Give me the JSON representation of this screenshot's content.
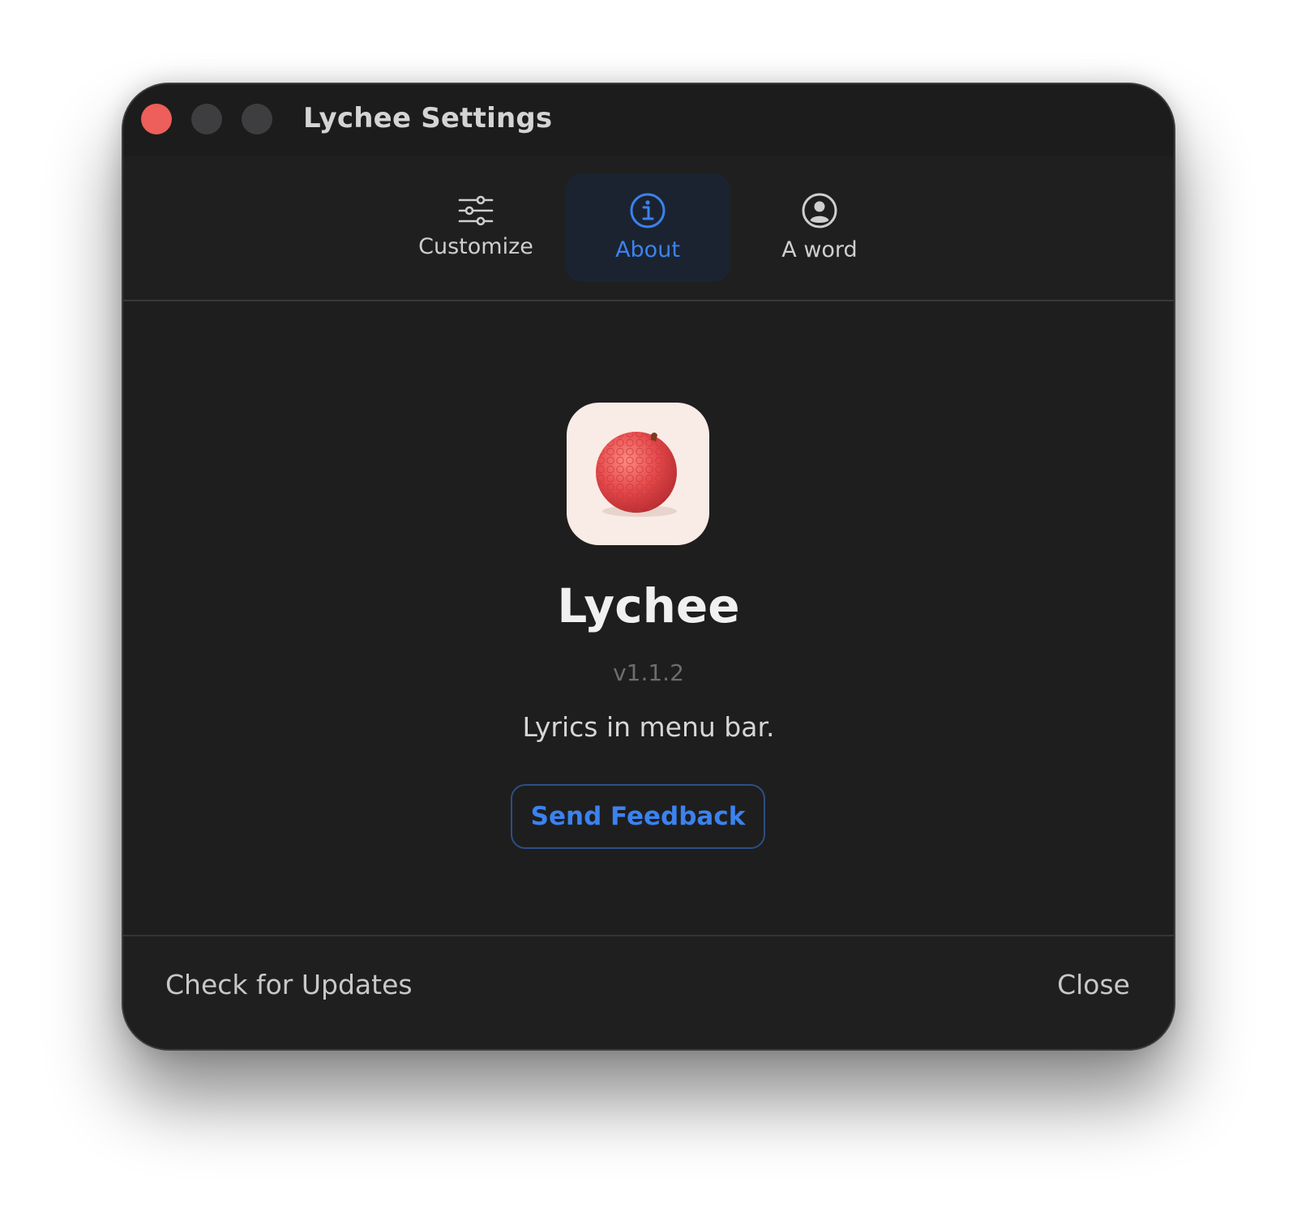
{
  "window": {
    "title": "Lychee Settings"
  },
  "toolbar": {
    "tabs": [
      {
        "label": "Customize",
        "icon": "sliders-icon",
        "selected": false
      },
      {
        "label": "About",
        "icon": "info-circle-icon",
        "selected": true
      },
      {
        "label": "A word",
        "icon": "person-circle-icon",
        "selected": false
      }
    ]
  },
  "about": {
    "app_icon": "lychee-fruit-icon",
    "app_name": "Lychee",
    "version": "v1.1.2",
    "tagline": "Lyrics in menu bar.",
    "feedback_label": "Send Feedback"
  },
  "footer": {
    "updates_label": "Check for Updates",
    "close_label": "Close"
  },
  "colors": {
    "accent": "#3b82f0",
    "window_bg": "#1e1e1e",
    "close_dot": "#ee5e5a",
    "inactive_dot": "#3e3e40",
    "icon_bg": "#f9ebe6",
    "fruit": "#e5484a"
  }
}
